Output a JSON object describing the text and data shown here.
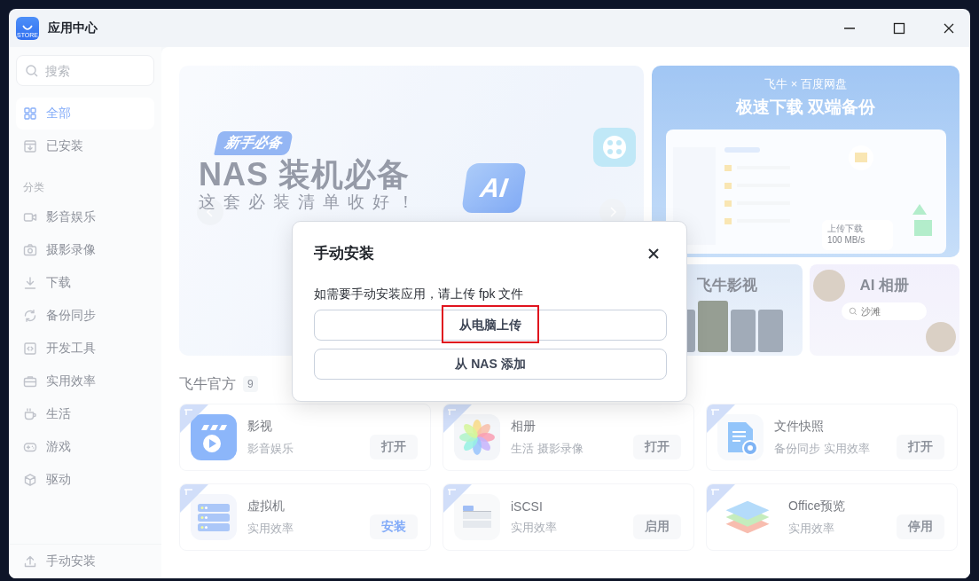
{
  "window": {
    "title": "应用中心",
    "logo_text": "STORE"
  },
  "sidebar": {
    "search": {
      "placeholder": "搜索"
    },
    "items": [
      {
        "label": "全部",
        "selected": true
      },
      {
        "label": "已安装",
        "selected": false
      }
    ],
    "category_heading": "分类",
    "categories": [
      {
        "label": "影音娱乐",
        "selected": false
      },
      {
        "label": "摄影录像",
        "selected": false
      },
      {
        "label": "下载",
        "selected": false
      },
      {
        "label": "备份同步",
        "selected": false
      },
      {
        "label": "开发工具",
        "selected": false
      },
      {
        "label": "实用效率",
        "selected": false
      },
      {
        "label": "生活",
        "selected": false
      },
      {
        "label": "游戏",
        "selected": false
      },
      {
        "label": "驱动",
        "selected": false
      }
    ],
    "footer_item": {
      "label": "手动安装"
    }
  },
  "banner": {
    "tag": "新手必备",
    "headline": "NAS 装机必备",
    "subline": "这套必装清单收好！",
    "ai_badge": "AI"
  },
  "promo": {
    "kicker": "飞牛 × 百度网盘",
    "headline": "极速下载 双端备份",
    "speed_label": "上传下载",
    "speed_value": "100 MB/s"
  },
  "tiles": [
    {
      "kind": "movies",
      "title": "飞牛影视"
    },
    {
      "kind": "photos",
      "title": "AI 相册",
      "search_text": "沙滩"
    }
  ],
  "section": {
    "title": "飞牛官方",
    "count": "9"
  },
  "apps": [
    {
      "name": "影视",
      "tags": "影音娱乐",
      "action": {
        "label": "打开",
        "primary": false
      }
    },
    {
      "name": "相册",
      "tags": "生活 摄影录像",
      "action": {
        "label": "打开",
        "primary": false
      }
    },
    {
      "name": "文件快照",
      "tags": "备份同步 实用效率",
      "action": {
        "label": "打开",
        "primary": false
      }
    },
    {
      "name": "虚拟机",
      "tags": "实用效率",
      "action": {
        "label": "安装",
        "primary": true
      }
    },
    {
      "name": "iSCSI",
      "tags": "实用效率",
      "action": {
        "label": "启用",
        "primary": false
      }
    },
    {
      "name": "Office预览",
      "tags": "实用效率",
      "action": {
        "label": "停用",
        "primary": false
      }
    }
  ],
  "dialog": {
    "title": "手动安装",
    "message": "如需要手动安装应用，请上传 fpk 文件",
    "buttons": [
      {
        "label": "从电脑上传",
        "highlighted": true
      },
      {
        "label": "从 NAS 添加",
        "highlighted": false
      }
    ]
  }
}
